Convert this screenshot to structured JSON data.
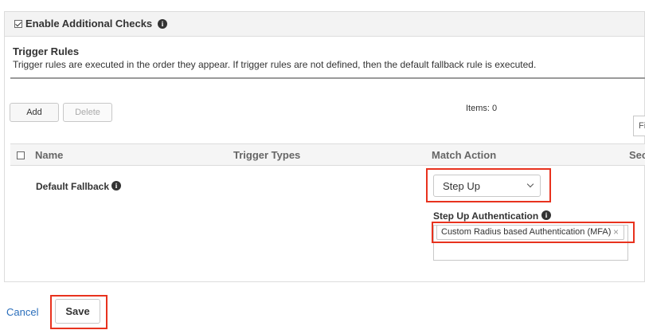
{
  "header": {
    "checkbox_checked": true,
    "label": "Enable Additional Checks"
  },
  "trigger_rules": {
    "title": "Trigger Rules",
    "description": "Trigger rules are executed in the order they appear. If trigger rules are not defined, then the default fallback rule is executed."
  },
  "toolbar": {
    "add_label": "Add",
    "delete_label": "Delete",
    "items_count": "Items: 0",
    "filter_placeholder": "Fi"
  },
  "table": {
    "columns": [
      "Name",
      "Trigger Types",
      "Match Action",
      "Sec"
    ],
    "rows": [
      {
        "name": "Default Fallback",
        "match_action": "Step Up",
        "step_up_label": "Step Up Authentication",
        "step_up_tag": "Custom Radius based Authentication (MFA)"
      }
    ]
  },
  "footer": {
    "cancel_label": "Cancel",
    "save_label": "Save"
  },
  "colors": {
    "highlight": "#e8321e",
    "link": "#2a6ebb",
    "header_bg": "#f3f3f3"
  }
}
